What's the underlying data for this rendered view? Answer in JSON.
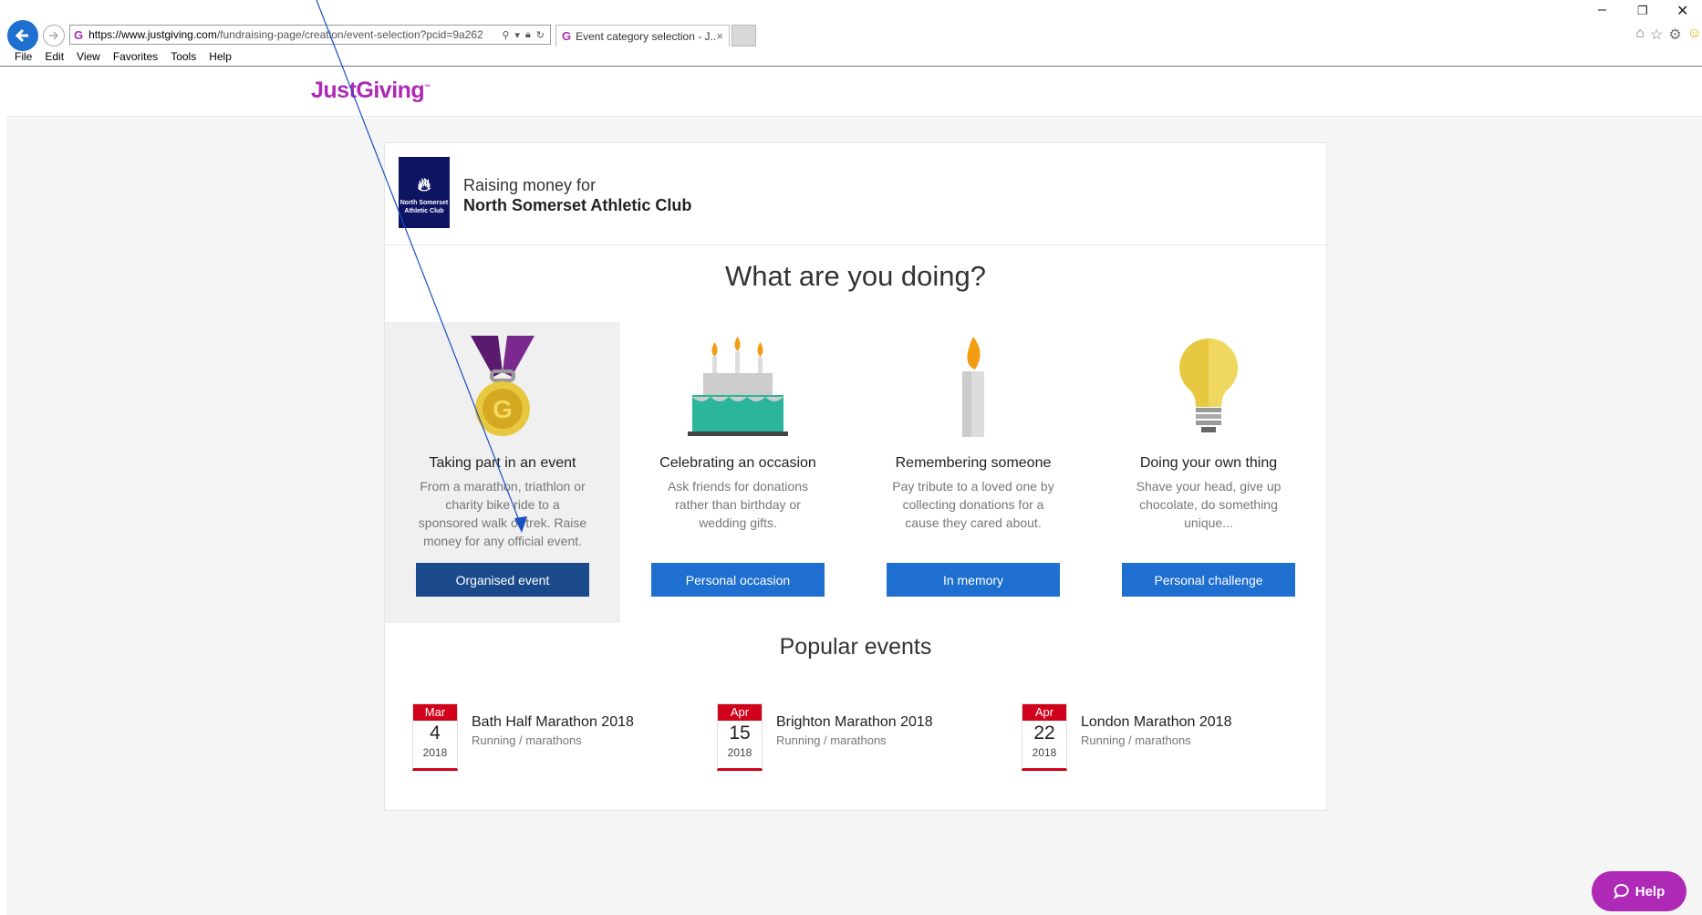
{
  "browser": {
    "url_domain": "https://www.justgiving.com",
    "url_rest": "/fundraising-page/creation/event-selection?pcid=9a262",
    "tab_title": "Event category selection - J...",
    "tab_close": "×",
    "window_controls": {
      "minimize": "–",
      "restore": "❐",
      "close": "✕"
    },
    "toolbar_icons": [
      "home-icon",
      "star-icon",
      "gear-icon",
      "smiley-icon"
    ],
    "menu": [
      "File",
      "Edit",
      "View",
      "Favorites",
      "Tools",
      "Help"
    ]
  },
  "site": {
    "logo": "JustGiving",
    "logo_tm": "™"
  },
  "charity": {
    "label": "Raising money for",
    "name": "North Somerset Athletic Club",
    "logo_text": "North Somerset Athletic Club"
  },
  "heading": "What are you doing?",
  "options": [
    {
      "title": "Taking part in an event",
      "desc": "From a marathon, triathlon or charity bike ride to a sponsored walk or trek. Raise money for any official event.",
      "button": "Organised event",
      "icon": "medal-icon"
    },
    {
      "title": "Celebrating an occasion",
      "desc": "Ask friends for donations rather than birthday or wedding gifts.",
      "button": "Personal occasion",
      "icon": "cake-icon"
    },
    {
      "title": "Remembering someone",
      "desc": "Pay tribute to a loved one by collecting donations for a cause they cared about.",
      "button": "In memory",
      "icon": "candle-icon"
    },
    {
      "title": "Doing your own thing",
      "desc": "Shave your head, give up chocolate, do something unique...",
      "button": "Personal challenge",
      "icon": "lightbulb-icon"
    }
  ],
  "popular_heading": "Popular events",
  "events": [
    {
      "month": "Mar",
      "day": "4",
      "year": "2018",
      "name": "Bath Half Marathon 2018",
      "category": "Running / marathons"
    },
    {
      "month": "Apr",
      "day": "15",
      "year": "2018",
      "name": "Brighton Marathon 2018",
      "category": "Running / marathons"
    },
    {
      "month": "Apr",
      "day": "22",
      "year": "2018",
      "name": "London Marathon 2018",
      "category": "Running / marathons"
    }
  ],
  "help_button": "Help",
  "colors": {
    "brand": "#ad29b6",
    "button": "#1e6fd0",
    "date_red": "#d0021b"
  }
}
